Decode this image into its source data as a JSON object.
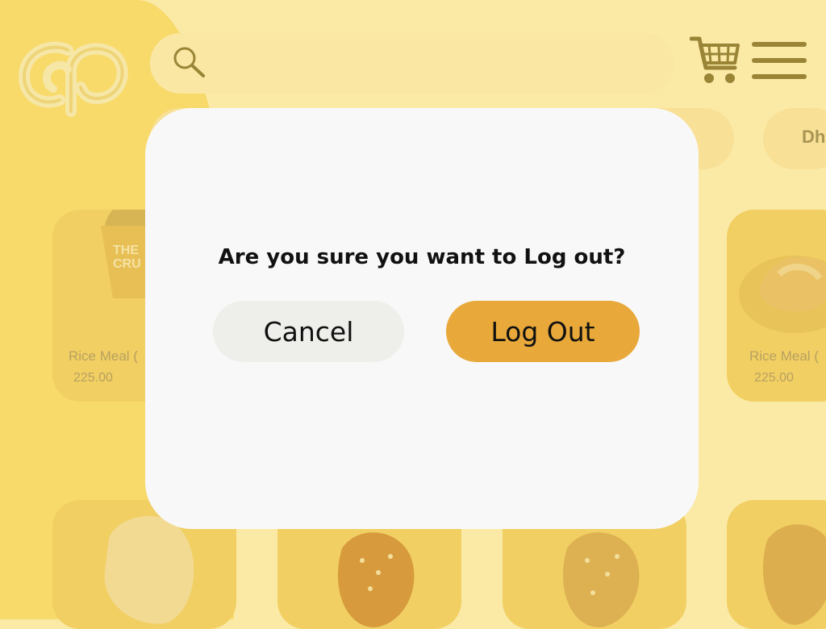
{
  "header": {
    "logo": "cp-logo",
    "search": {
      "icon": "search-icon",
      "placeholder": ""
    },
    "cart_icon": "cart-icon",
    "menu_icon": "hamburger-menu-icon"
  },
  "categories": [
    {
      "label": ""
    },
    {
      "label": "Dh"
    }
  ],
  "products": [
    {
      "name": "Rice Meal (",
      "price": "225.00"
    },
    {
      "name": "Rice Meal (",
      "price": "225.00"
    }
  ],
  "dialog": {
    "message": "Are you sure you want to Log out?",
    "cancel_label": "Cancel",
    "logout_label": "Log Out"
  },
  "colors": {
    "background": "#fbe9a6",
    "accent_yellow": "#f8da6b",
    "dialog_bg": "#f8f8f8",
    "cancel_bg": "#eeeeea",
    "logout_bg": "#e8a83a"
  }
}
